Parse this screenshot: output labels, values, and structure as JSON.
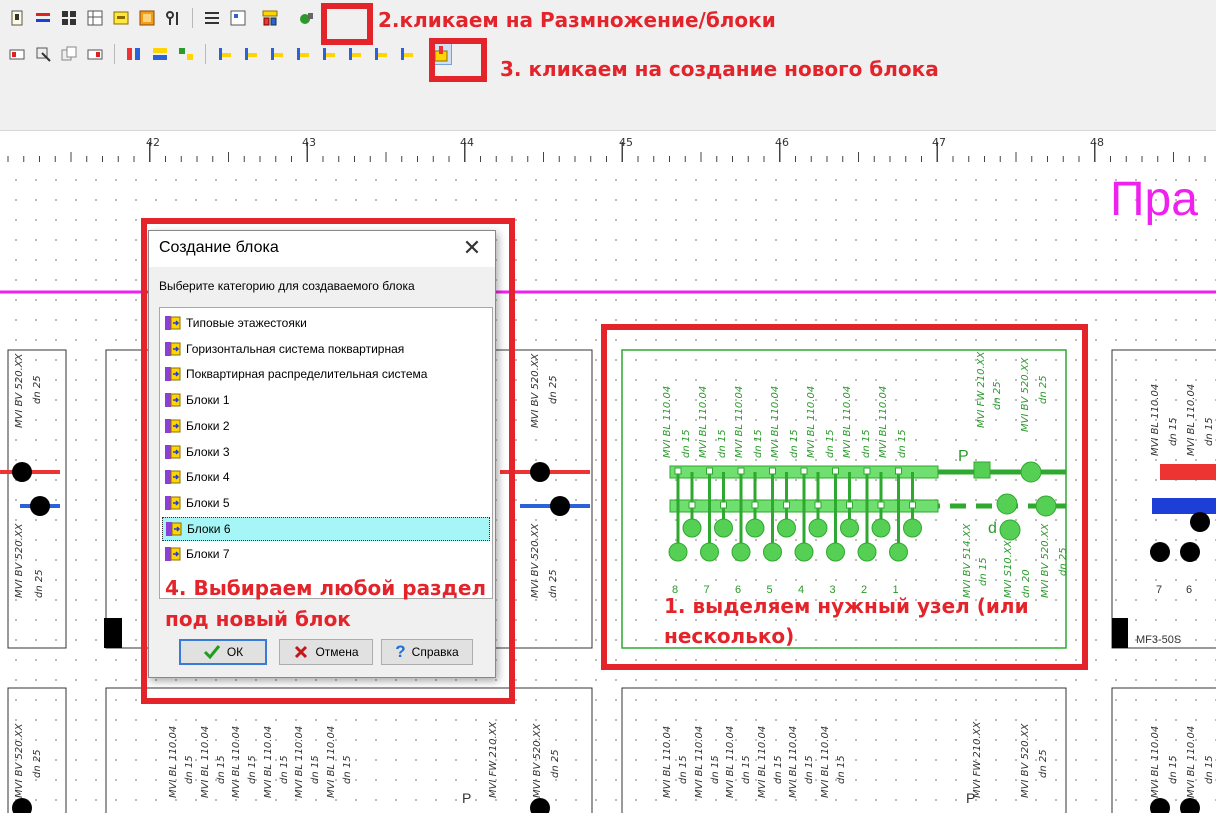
{
  "annotations": {
    "step2": "2.кликаем на Размножение/блоки",
    "step3": "3. кликаем на создание нового блока",
    "step4_line1": "4. Выбираем любой раздел",
    "step4_line2": "под новый блок",
    "step1_line1": "1. выделяем нужный узел (или",
    "step1_line2": "несколько)"
  },
  "ruler": {
    "numbers": [
      "42",
      "43",
      "44",
      "45",
      "46",
      "47",
      "48"
    ]
  },
  "canvas": {
    "title_fragment": "Пра",
    "labels": {
      "mvi_bl": "MVI BL 110.04",
      "mvi_bv": "MVI BV 520.XX",
      "mvi_fw": "MVI FW 210.XX",
      "mvi_bv514": "MVI BV 514.XX",
      "mvi_s510": "MVI S10.XX",
      "dn15": "dn 15",
      "dn20": "dn 20",
      "dn25": "dn 25",
      "mf3": "MF3-50S",
      "p": "P",
      "d": "d",
      "node_numbers": [
        "8",
        "7",
        "6",
        "5",
        "4",
        "3",
        "2",
        "1"
      ],
      "right_numbers": [
        "7",
        "6"
      ]
    }
  },
  "dialog": {
    "title": "Создание блока",
    "close": "✕",
    "prompt": "Выберите категорию для создаваемого блока",
    "categories": [
      "Типовые этажестояки",
      "Горизонтальная система поквартирная",
      "Поквартирная распределительная система",
      "Блоки 1",
      "Блоки 2",
      "Блоки 3",
      "Блоки 4",
      "Блоки 5",
      "Блоки 6",
      "Блоки 7"
    ],
    "selected_index": 8,
    "buttons": {
      "ok": "ОК",
      "cancel": "Отмена",
      "help": "Справка"
    }
  },
  "colors": {
    "annotation_red": "#e3242b",
    "magenta_line": "#ee21ee",
    "node_green": "#2ea82e",
    "selection_cyan": "#a6f6f8"
  },
  "icons": [
    "toolbar-icons",
    "close-icon",
    "checkmark-icon",
    "cross-icon",
    "help-icon",
    "block-category-icon"
  ]
}
